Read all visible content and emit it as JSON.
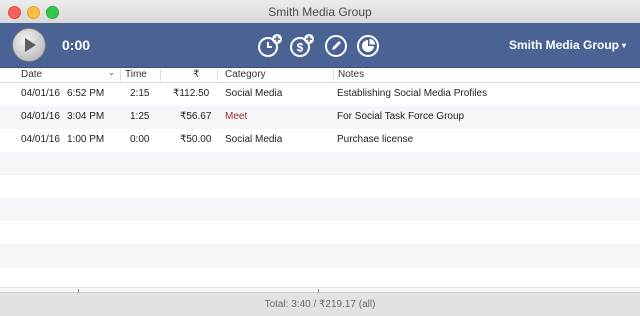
{
  "window": {
    "title": "Smith Media Group"
  },
  "toolbar": {
    "timer": "0:00",
    "client_name": "Smith Media Group",
    "client_caret": "▾",
    "tools": [
      {
        "name": "add-time-button",
        "icon": "clock-plus-icon"
      },
      {
        "name": "add-expense-button",
        "icon": "dollar-plus-icon"
      },
      {
        "name": "edit-button",
        "icon": "pencil-icon"
      },
      {
        "name": "report-button",
        "icon": "pie-chart-icon"
      }
    ]
  },
  "table": {
    "columns": [
      "Date",
      "Time",
      "₹",
      "Category",
      "Notes"
    ],
    "rows": [
      {
        "date": "04/01/16",
        "clock": "6:52 PM",
        "time": "2:15",
        "amount": "₹112.50",
        "category": "Social Media",
        "notes": "Establishing Social Media Profiles"
      },
      {
        "date": "04/01/16",
        "clock": "3:04 PM",
        "time": "1:25",
        "amount": "₹56.67",
        "category": "Meet",
        "notes": "For Social Task Force Group"
      },
      {
        "date": "04/01/16",
        "clock": "1:00 PM",
        "time": "0:00",
        "amount": "₹50.00",
        "category": "Social Media",
        "notes": "Purchase license"
      }
    ]
  },
  "footer": {
    "total": "Total: 3:40 / ₹219.17 (all)"
  },
  "colors": {
    "toolbar": "#4a6394",
    "meet_category": "#9a2d1f",
    "stripe": "#f3f5f9"
  }
}
